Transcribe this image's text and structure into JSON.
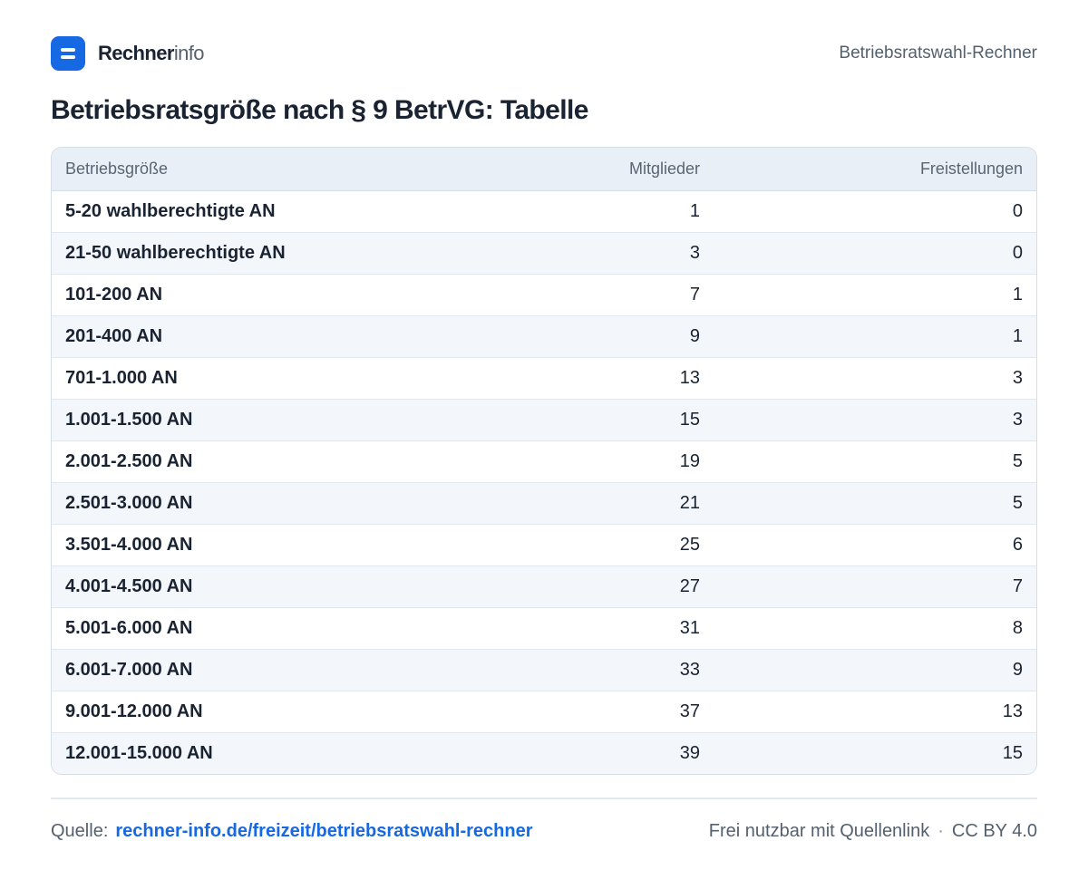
{
  "header": {
    "brand_bold": "Rechner",
    "brand_light": "info",
    "right_label": "Betriebsratswahl-Rechner"
  },
  "title": "Betriebsratsgröße nach § 9 BetrVG: Tabelle",
  "table": {
    "columns": [
      "Betriebsgröße",
      "Mitglieder",
      "Freistellungen"
    ],
    "rows": [
      [
        "5-20 wahlberechtigte AN",
        "1",
        "0"
      ],
      [
        "21-50 wahlberechtigte AN",
        "3",
        "0"
      ],
      [
        "101-200 AN",
        "7",
        "1"
      ],
      [
        "201-400 AN",
        "9",
        "1"
      ],
      [
        "701-1.000 AN",
        "13",
        "3"
      ],
      [
        "1.001-1.500 AN",
        "15",
        "3"
      ],
      [
        "2.001-2.500 AN",
        "19",
        "5"
      ],
      [
        "2.501-3.000 AN",
        "21",
        "5"
      ],
      [
        "3.501-4.000 AN",
        "25",
        "6"
      ],
      [
        "4.001-4.500 AN",
        "27",
        "7"
      ],
      [
        "5.001-6.000 AN",
        "31",
        "8"
      ],
      [
        "6.001-7.000 AN",
        "33",
        "9"
      ],
      [
        "9.001-12.000 AN",
        "37",
        "13"
      ],
      [
        "12.001-15.000 AN",
        "39",
        "15"
      ]
    ]
  },
  "footer": {
    "source_label": "Quelle:",
    "source_link": "rechner-info.de/freizeit/betriebsratswahl-rechner",
    "usage_note": "Frei nutzbar mit Quellenlink",
    "separator": "·",
    "license": "CC BY 4.0"
  },
  "colors": {
    "accent": "#1668e3",
    "text": "#1a2332",
    "muted": "#55606e",
    "header_bg": "#e9eff6",
    "stripe_bg": "#f3f6fa"
  }
}
